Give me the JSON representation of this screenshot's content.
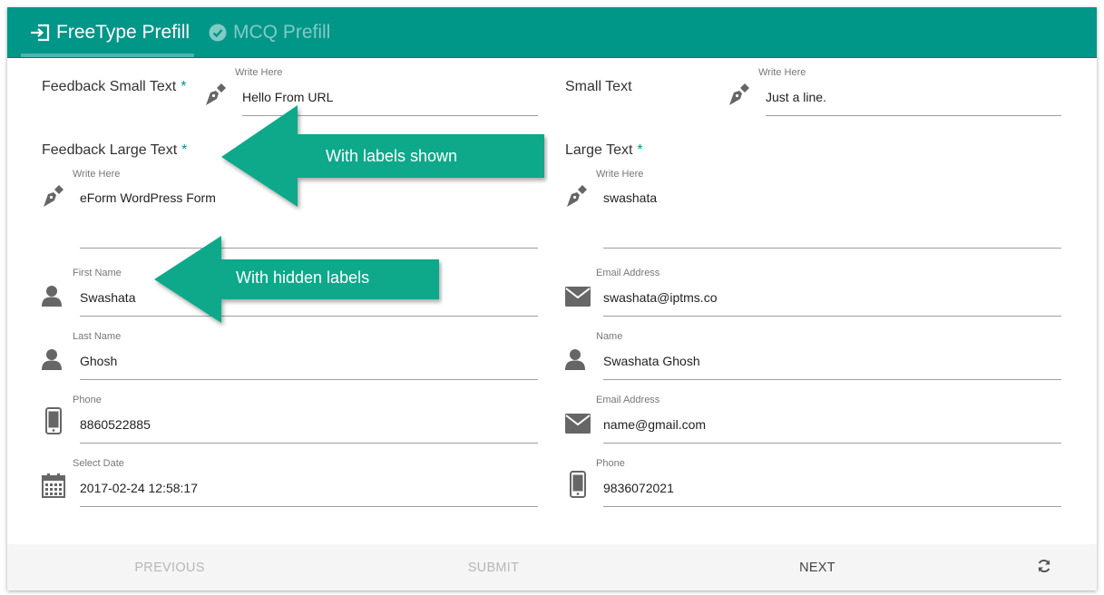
{
  "tabs": [
    {
      "label": "FreeType Prefill",
      "icon": "sign-in-icon",
      "active": true
    },
    {
      "label": "MCQ Prefill",
      "icon": "check-circle-icon",
      "active": false
    }
  ],
  "left": {
    "small_text": {
      "title": "Feedback Small Text",
      "required": "*",
      "label": "Write Here",
      "value": "Hello From URL"
    },
    "large_text": {
      "title": "Feedback Large Text",
      "required": "*",
      "label": "Write Here",
      "value": "eForm WordPress Form"
    },
    "first_name": {
      "label": "First Name",
      "value": "Swashata"
    },
    "last_name": {
      "label": "Last Name",
      "value": "Ghosh"
    },
    "phone": {
      "label": "Phone",
      "value": "8860522885"
    },
    "date": {
      "label": "Select Date",
      "value": "2017-02-24 12:58:17"
    }
  },
  "right": {
    "small_text": {
      "title": "Small Text",
      "label": "Write Here",
      "value": "Just a line."
    },
    "large_text": {
      "title": "Large Text",
      "required": "*",
      "label": "Write Here",
      "value": "swashata"
    },
    "email1": {
      "label": "Email Address",
      "value": "swashata@iptms.co"
    },
    "name": {
      "label": "Name",
      "value": "Swashata Ghosh"
    },
    "email2": {
      "label": "Email Address",
      "value": "name@gmail.com"
    },
    "phone": {
      "label": "Phone",
      "value": "9836072021"
    }
  },
  "footer": {
    "previous": "PREVIOUS",
    "submit": "SUBMIT",
    "next": "NEXT",
    "reset_icon": "refresh-icon"
  },
  "callouts": {
    "shown": "With labels shown",
    "hidden": "With hidden labels"
  },
  "colors": {
    "primary": "#009688",
    "callout": "#10a98a"
  }
}
